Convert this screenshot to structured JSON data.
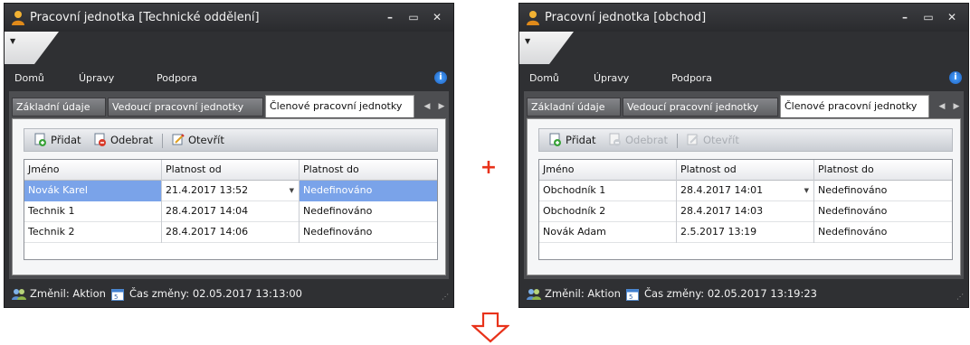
{
  "windows": [
    {
      "title": "Pracovní jednotka [Technické oddělení]",
      "menu": [
        "Domů",
        "Úpravy",
        "Podpora"
      ],
      "tabs": [
        "Základní údaje",
        "Vedoucí pracovní jednotky",
        "Členové pracovní jednotky"
      ],
      "active_tab": 2,
      "toolbar": {
        "add_label": "Přidat",
        "remove_label": "Odebrat",
        "open_label": "Otevřít",
        "remove_enabled": true,
        "open_enabled": true
      },
      "grid": {
        "columns": [
          "Jméno",
          "Platnost od",
          "Platnost do"
        ],
        "rows": [
          [
            "Novák Karel",
            "21.4.2017 13:52",
            "Nedefinováno"
          ],
          [
            "Technik 1",
            "28.4.2017 14:04",
            "Nedefinováno"
          ],
          [
            "Technik 2",
            "28.4.2017 14:06",
            "Nedefinováno"
          ]
        ],
        "selected_row": 0
      },
      "status": {
        "changed_by": "Změnil: Aktion",
        "change_time": "Čas změny: 02.05.2017 13:13:00"
      }
    },
    {
      "title": "Pracovní jednotka [obchod]",
      "menu": [
        "Domů",
        "Úpravy",
        "Podpora"
      ],
      "tabs": [
        "Základní údaje",
        "Vedoucí pracovní jednotky",
        "Členové pracovní jednotky"
      ],
      "active_tab": 2,
      "toolbar": {
        "add_label": "Přidat",
        "remove_label": "Odebrat",
        "open_label": "Otevřít",
        "remove_enabled": false,
        "open_enabled": false
      },
      "grid": {
        "columns": [
          "Jméno",
          "Platnost od",
          "Platnost do"
        ],
        "rows": [
          [
            "Obchodník 1",
            "28.4.2017 14:01",
            "Nedefinováno"
          ],
          [
            "Obchodník 2",
            "28.4.2017 14:03",
            "Nedefinováno"
          ],
          [
            "Novák Adam",
            "2.5.2017 13:19",
            "Nedefinováno"
          ]
        ],
        "selected_row": null
      },
      "status": {
        "changed_by": "Změnil: Aktion",
        "change_time": "Čas změny: 02.05.2017 13:19:23"
      }
    }
  ],
  "operator": "+",
  "arrow_icon": "down-arrow-icon",
  "colors": {
    "chrome": "#2f3033",
    "selection": "#7aa3e9",
    "operator": "#e8321a"
  }
}
